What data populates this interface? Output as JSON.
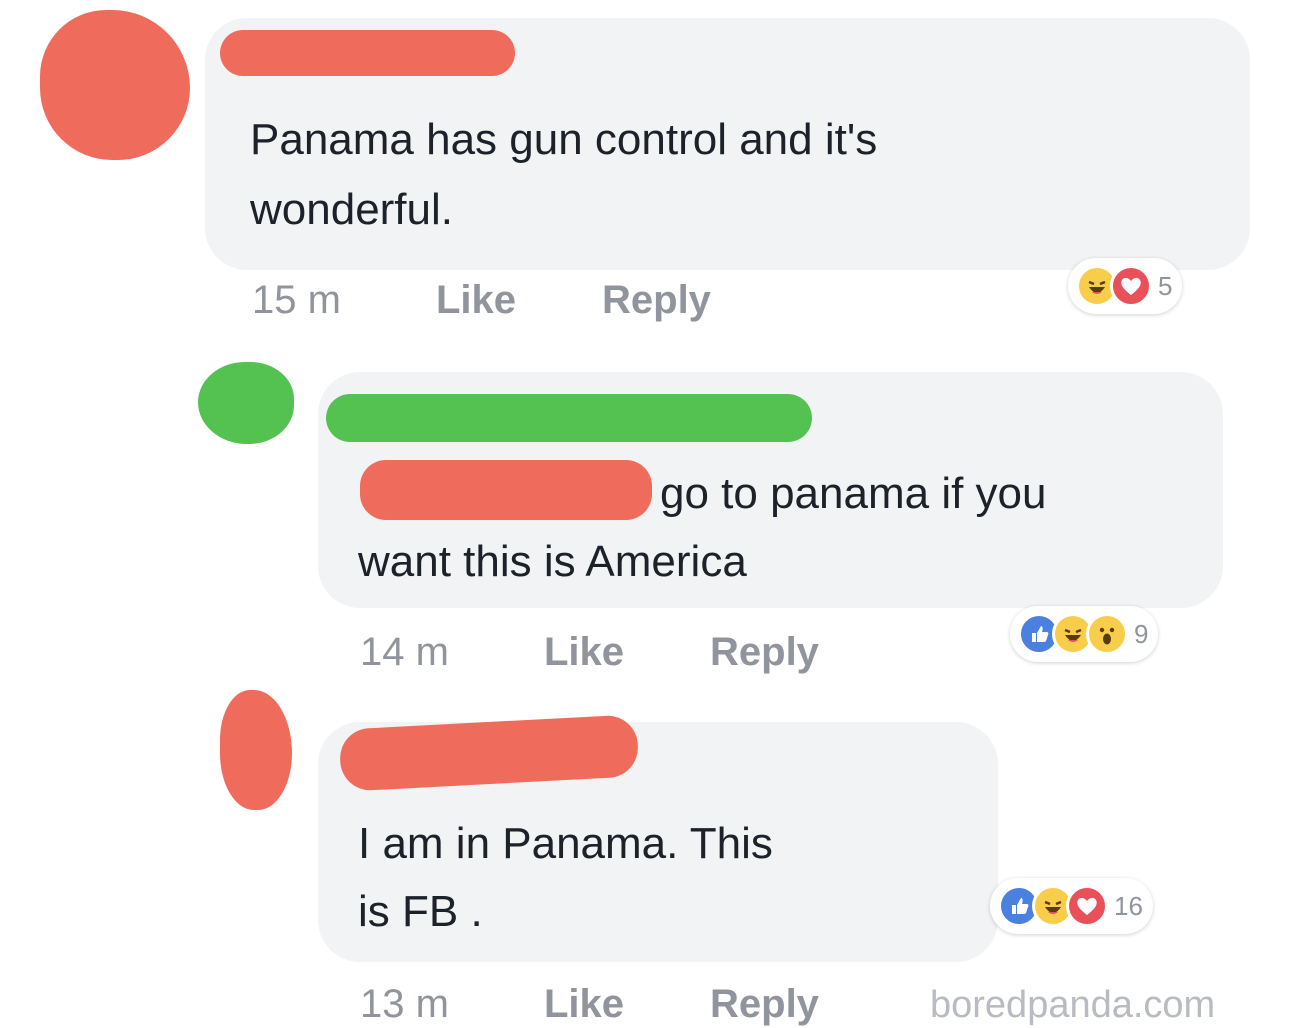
{
  "comments": [
    {
      "text_line1": "Panama has gun control and it's",
      "text_line2": "wonderful.",
      "time": "15 m",
      "like_label": "Like",
      "reply_label": "Reply",
      "reactions": [
        "haha",
        "love"
      ],
      "reaction_count": "5"
    },
    {
      "text_line1": "go to panama if you",
      "text_line2": "want this is America",
      "time": "14 m",
      "like_label": "Like",
      "reply_label": "Reply",
      "reactions": [
        "like",
        "haha",
        "wow"
      ],
      "reaction_count": "9"
    },
    {
      "text_line1": "I am in Panama.  This",
      "text_line2": "is FB .",
      "time": "13 m",
      "like_label": "Like",
      "reply_label": "Reply",
      "reactions": [
        "like",
        "haha",
        "love"
      ],
      "reaction_count": "16"
    }
  ],
  "watermark": "boredpanda.com",
  "colors": {
    "redaction_red": "#ef6b5c",
    "redaction_green": "#54c250",
    "bubble_bg": "#f2f3f5",
    "meta_gray": "#90949c",
    "like_blue": "#4a80e0"
  }
}
